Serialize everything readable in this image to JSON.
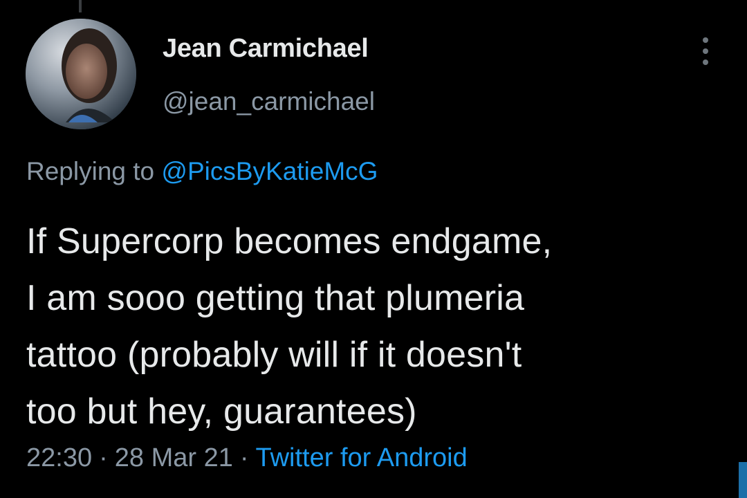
{
  "tweet": {
    "author": {
      "display_name": "Jean Carmichael",
      "handle": "@jean_carmichael"
    },
    "reply_context": {
      "prefix": "Replying to",
      "mention": "@PicsByKatieMcG"
    },
    "text_lines": [
      "If Supercorp becomes endgame,",
      "I am sooo getting that plumeria",
      "tattoo (probably will if it doesn't",
      "too but hey, guarantees)"
    ],
    "time": "22:30",
    "date": "28 Mar 21",
    "separator": "·",
    "source": "Twitter for Android"
  },
  "icons": {
    "more": "more-vertical-icon"
  },
  "colors": {
    "background": "#000000",
    "primary_text": "#e7e9ea",
    "secondary_text": "#8b98a5",
    "accent": "#1d9bf0"
  }
}
